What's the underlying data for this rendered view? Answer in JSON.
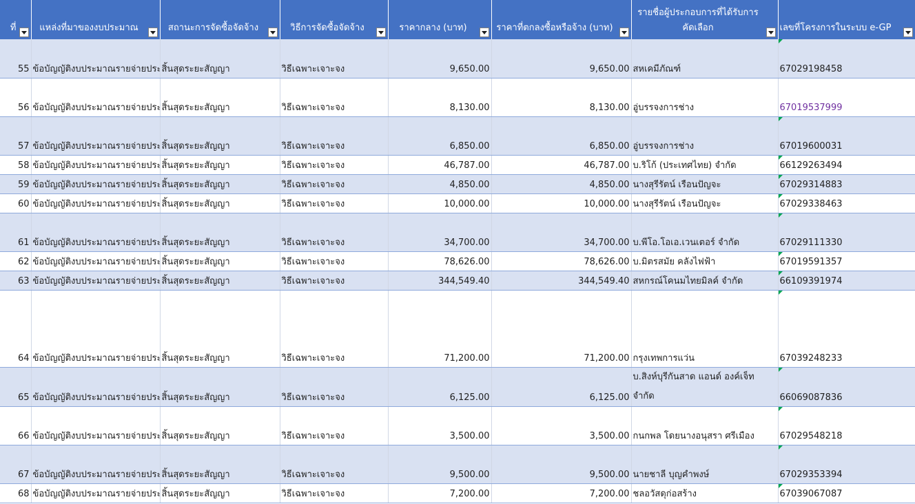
{
  "headers": {
    "col0": "ที่",
    "col1": "แหล่งที่มาของงบประมาณ",
    "col2": "สถานะการจัดซื้อจัดจ้าง",
    "col3": "วิธีการจัดซื้อจัดจ้าง",
    "col4": "ราคากลาง (บาท)",
    "col5": "ราคาที่ตกลงซื้อหรือจ้าง (บาท)",
    "col6_line1": "รายชื่อผู้ประกอบการที่ได้รับการ",
    "col6_line2": "คัดเลือก",
    "col7": "เลขที่โครงการในระบบ e-GP"
  },
  "rows": [
    {
      "no": "55",
      "source": "ข้อบัญญัติงบประมาณรายจ่ายประ",
      "status": "สิ้นสุดระยะสัญญา",
      "method": "วิธีเฉพาะเจาะจง",
      "ref_price": "9,650.00",
      "agreed_price": "9,650.00",
      "vendor": "สหเคมีภัณฑ์",
      "vendor2": "",
      "egp": "67029198458"
    },
    {
      "no": "56",
      "source": "ข้อบัญญัติงบประมาณรายจ่ายประ",
      "status": "สิ้นสุดระยะสัญญา",
      "method": "วิธีเฉพาะเจาะจง",
      "ref_price": "8,130.00",
      "agreed_price": "8,130.00",
      "vendor": "อู่บรรจงการช่าง",
      "vendor2": "",
      "egp": "67019537999"
    },
    {
      "no": "57",
      "source": "ข้อบัญญัติงบประมาณรายจ่ายประ",
      "status": "สิ้นสุดระยะสัญญา",
      "method": "วิธีเฉพาะเจาะจง",
      "ref_price": "6,850.00",
      "agreed_price": "6,850.00",
      "vendor": "อู่บรรจงการช่าง",
      "vendor2": "",
      "egp": "67019600031"
    },
    {
      "no": "58",
      "source": "ข้อบัญญัติงบประมาณรายจ่ายประ",
      "status": "สิ้นสุดระยะสัญญา",
      "method": "วิธีเฉพาะเจาะจง",
      "ref_price": "46,787.00",
      "agreed_price": "46,787.00",
      "vendor": "บ.ริโก้ (ประเทศไทย) จำกัด",
      "vendor2": "",
      "egp": "66129263494"
    },
    {
      "no": "59",
      "source": "ข้อบัญญัติงบประมาณรายจ่ายประ",
      "status": "สิ้นสุดระยะสัญญา",
      "method": "วิธีเฉพาะเจาะจง",
      "ref_price": "4,850.00",
      "agreed_price": "4,850.00",
      "vendor": "นางสุรีรัตน์ เรือนปัญจะ",
      "vendor2": "",
      "egp": "67029314883"
    },
    {
      "no": "60",
      "source": "ข้อบัญญัติงบประมาณรายจ่ายประ",
      "status": "สิ้นสุดระยะสัญญา",
      "method": "วิธีเฉพาะเจาะจง",
      "ref_price": "10,000.00",
      "agreed_price": "10,000.00",
      "vendor": "นางสุรีรัตน์ เรือนปัญจะ",
      "vendor2": "",
      "egp": "67029338463"
    },
    {
      "no": "61",
      "source": "ข้อบัญญัติงบประมาณรายจ่ายประ",
      "status": "สิ้นสุดระยะสัญญา",
      "method": "วิธีเฉพาะเจาะจง",
      "ref_price": "34,700.00",
      "agreed_price": "34,700.00",
      "vendor": "บ.พีโอ.โอเอ.เวนเตอร์ จำกัด",
      "vendor2": "",
      "egp": "67029111330"
    },
    {
      "no": "62",
      "source": "ข้อบัญญัติงบประมาณรายจ่ายประ",
      "status": "สิ้นสุดระยะสัญญา",
      "method": "วิธีเฉพาะเจาะจง",
      "ref_price": "78,626.00",
      "agreed_price": "78,626.00",
      "vendor": "บ.มิตรสมัย คลังไฟฟ้า",
      "vendor2": "",
      "egp": "67019591357"
    },
    {
      "no": "63",
      "source": "ข้อบัญญัติงบประมาณรายจ่ายประ",
      "status": "สิ้นสุดระยะสัญญา",
      "method": "วิธีเฉพาะเจาะจง",
      "ref_price": "344,549.40",
      "agreed_price": "344,549.40",
      "vendor": "สหกรณ์โคนมไทยมิลค์ จำกัด",
      "vendor2": "",
      "egp": "66109391974"
    },
    {
      "no": "64",
      "source": "ข้อบัญญัติงบประมาณรายจ่ายประ",
      "status": "สิ้นสุดระยะสัญญา",
      "method": "วิธีเฉพาะเจาะจง",
      "ref_price": "71,200.00",
      "agreed_price": "71,200.00",
      "vendor": "กรุงเทพการแว่น",
      "vendor2": "",
      "egp": "67039248233"
    },
    {
      "no": "65",
      "source": "ข้อบัญญัติงบประมาณรายจ่ายประ",
      "status": "สิ้นสุดระยะสัญญา",
      "method": "วิธีเฉพาะเจาะจง",
      "ref_price": "6,125.00",
      "agreed_price": "6,125.00",
      "vendor": "บ.สิงห์บุรีกันสาด แอนด์ องค์เจ็ท",
      "vendor2": "จำกัด",
      "egp": "66069087836"
    },
    {
      "no": "66",
      "source": "ข้อบัญญัติงบประมาณรายจ่ายประ",
      "status": "สิ้นสุดระยะสัญญา",
      "method": "วิธีเฉพาะเจาะจง",
      "ref_price": "3,500.00",
      "agreed_price": "3,500.00",
      "vendor": "กนกพล โดยนางอนุสรา ศรีเมือง",
      "vendor2": "",
      "egp": "67029548218"
    },
    {
      "no": "67",
      "source": "ข้อบัญญัติงบประมาณรายจ่ายประ",
      "status": "สิ้นสุดระยะสัญญา",
      "method": "วิธีเฉพาะเจาะจง",
      "ref_price": "9,500.00",
      "agreed_price": "9,500.00",
      "vendor": "นายชาลี บุญคำพงษ์",
      "vendor2": "",
      "egp": "67029353394"
    },
    {
      "no": "68",
      "source": "ข้อบัญญัติงบประมาณรายจ่ายประ",
      "status": "สิ้นสุดระยะสัญญา",
      "method": "วิธีเฉพาะเจาะจง",
      "ref_price": "7,200.00",
      "agreed_price": "7,200.00",
      "vendor": "ชลอวัสดุก่อสร้าง",
      "vendor2": "",
      "egp": "67039067087"
    }
  ]
}
